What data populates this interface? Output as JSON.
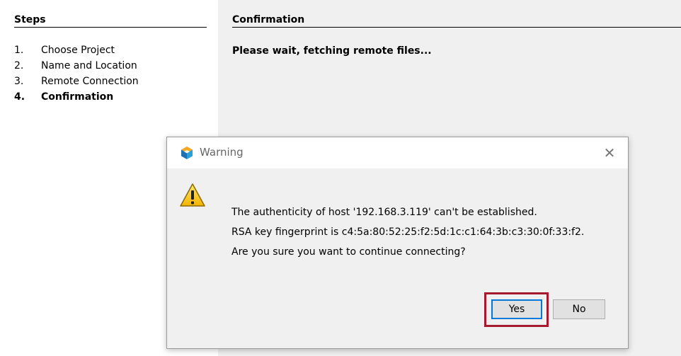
{
  "steps_pane": {
    "header": "Steps",
    "items": [
      {
        "num": "1.",
        "label": "Choose Project"
      },
      {
        "num": "2.",
        "label": "Name and Location"
      },
      {
        "num": "3.",
        "label": "Remote Connection"
      },
      {
        "num": "4.",
        "label": "Confirmation"
      }
    ],
    "current_index": 3
  },
  "content_pane": {
    "header": "Confirmation",
    "message": "Please wait, fetching remote files..."
  },
  "dialog": {
    "title": "Warning",
    "close_glyph": "✕",
    "lines": [
      "The authenticity of host '192.168.3.119' can't be established.",
      "RSA key fingerprint is c4:5a:80:52:25:f2:5d:1c:c1:64:3b:c3:30:0f:33:f2.",
      "Are you sure you want to continue connecting?"
    ],
    "yes_label": "Yes",
    "no_label": "No",
    "app_icon": "netbeans-cube-icon",
    "warning_icon": "warning-triangle-icon",
    "highlight_color": "#a6192e"
  }
}
